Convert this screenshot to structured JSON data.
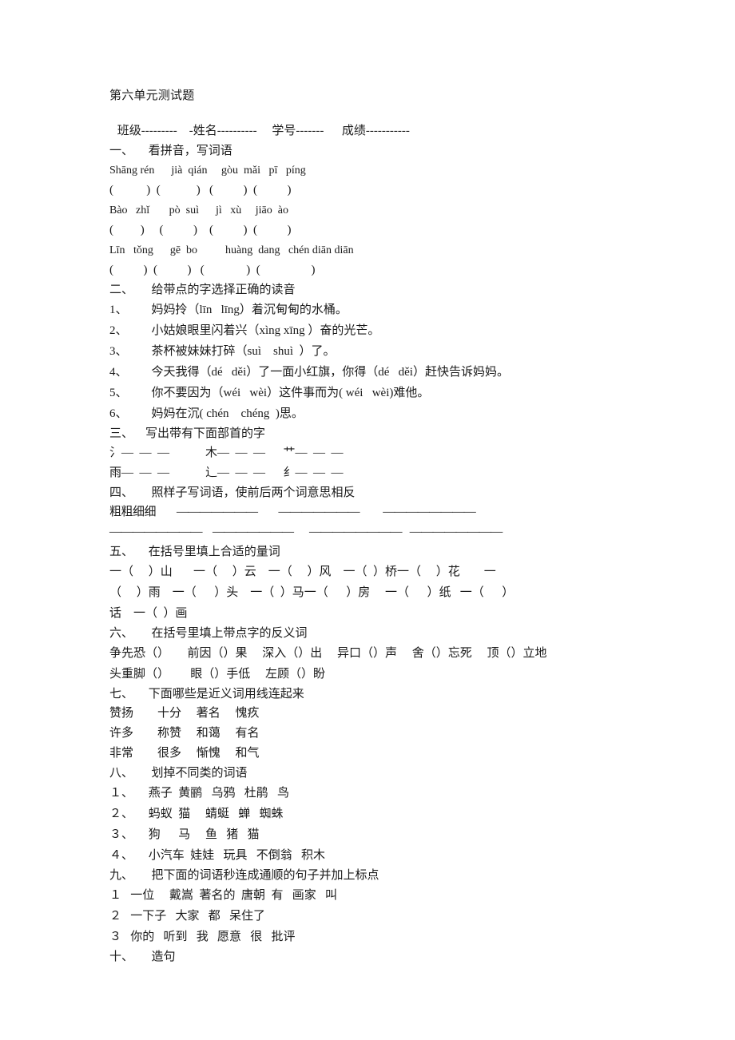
{
  "document": {
    "title": "第六单元测试题",
    "meta_line": " 班级---------    -姓名----------     学号-------      成绩-----------"
  },
  "sections": [
    {
      "heading": "一、     看拼音，写词语",
      "pinyin_rows": [
        {
          "pinyin": "Shāng rén      jià  qián     gòu  mǎi   pī   píng",
          "answer_boxes": "(           )  (            )   (          )  (          )"
        },
        {
          "pinyin": "Bào   zhǐ       pò  suì      jì   xù     jiāo  ào",
          "answer_boxes": "(         )     (          )    (          )  (          )"
        },
        {
          "pinyin": "Līn   tǒng      gē  bo          huàng  dang   chén diān diān",
          "answer_boxes": "(          )  (          )   (              )  (                 )"
        }
      ]
    },
    {
      "heading": "二、      给带点的字选择正确的读音",
      "questions": [
        "1、        妈妈拎（līn   līng）着沉甸甸的水桶。",
        "2、        小姑娘眼里闪着兴（xìng xīng ）奋的光芒。",
        "3、        茶杯被妹妹打碎（suì    shuì  ）了。",
        "4、        今天我得（dé   děi）了一面小红旗，你得（dé   děi）赶快告诉妈妈。",
        "5、        你不要因为（wéi   wèi）这件事而为( wéi   wèi)难他。",
        "6、        妈妈在沉( chén    chéng  )思。"
      ]
    },
    {
      "heading": "三、    写出带有下面部首的字",
      "radical_rows": [
        "氵—  —  —            木—  —  —      艹—  —  —",
        "雨—  —  —            辶—  —  —      纟—  —  —"
      ]
    },
    {
      "heading": "四、      照样子写词语，使前后两个词意思相反",
      "example": "粗粗细细",
      "blank_rows": [
        "粗粗细细        ———————        ———————         ————————",
        "————————    ———————      ————————   ————————"
      ]
    },
    {
      "heading": "五、     在括号里填上合适的量词",
      "measure_rows": [
        "一（     ）山       一（     ）云    一（     ）风    一（  ）桥一（     ）花        一",
        "（     ）雨    一（      ）头    一（  ）马一（      ）房     一（      ）纸   一（      ）",
        "话    一（  ）画"
      ]
    },
    {
      "heading": "六、      在括号里填上带点字的反义词",
      "idiom_rows": [
        "争先恐（）      前因（）果     深入（）出     异口（）声     舍（）忘死     顶（）立地",
        "头重脚（）       眼（）手低     左顾（）盼"
      ]
    },
    {
      "heading": "七、     下面哪些是近义词用线连起来",
      "match_rows": [
        "赞扬        十分     著名     愧疚",
        "许多        称赞     和蔼     有名",
        "非常        很多     惭愧     和气"
      ]
    },
    {
      "heading": "八、      划掉不同类的词语",
      "category_rows": [
        "１、     燕子  黄鹂   乌鸦   杜鹃   鸟",
        "２、     蚂蚁  猫     蜻蜓   蝉   蜘蛛",
        "３、     狗      马     鱼   猪   猫",
        "４、     小汽车  娃娃   玩具   不倒翁   积木"
      ]
    },
    {
      "heading": "九、      把下面的词语秒连成通顺的句子并加上标点",
      "sentence_rows": [
        "１   一位     戴嵩  著名的  唐朝  有   画家   叫",
        "２   一下子   大家   都   呆住了",
        "３   你的   听到   我   愿意   很   批评"
      ]
    },
    {
      "heading": "十、      造句"
    }
  ]
}
